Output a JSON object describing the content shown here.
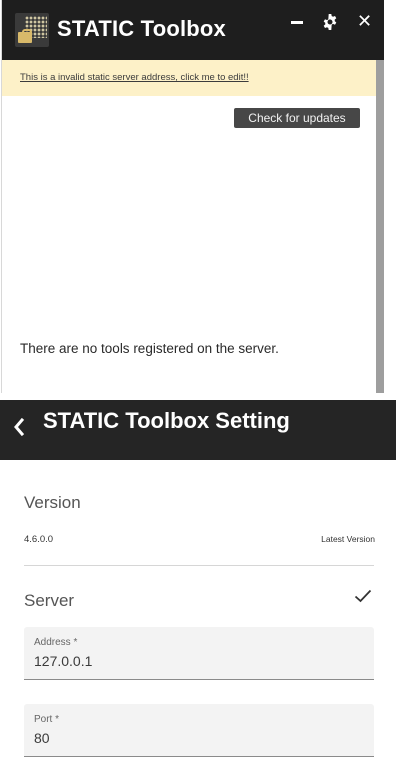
{
  "toolbox": {
    "title": "STATIC Toolbox",
    "icons": {
      "minimize": "minimize-icon",
      "settings": "gear-icon",
      "close": "close-icon"
    },
    "warning_link": "This is a invalid static server address, click me to edit!!",
    "check_updates_label": "Check for updates",
    "empty_message": "There are no tools registered on the server.",
    "colors": {
      "titlebar": "#1e1e1e",
      "warning_bg": "#fdf1c8",
      "button_bg": "#474747"
    }
  },
  "settings": {
    "title": "STATIC Toolbox Setting",
    "back_icon": "chevron-left-icon",
    "version": {
      "heading": "Version",
      "number": "4.6.0.0",
      "status": "Latest Version"
    },
    "server": {
      "heading": "Server",
      "status_icon": "check-icon",
      "address": {
        "label": "Address *",
        "value": "127.0.0.1"
      },
      "port": {
        "label": "Port *",
        "value": "80"
      }
    }
  }
}
